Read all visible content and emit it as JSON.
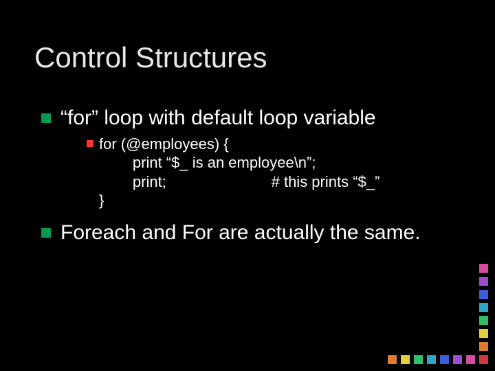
{
  "title": "Control Structures",
  "items": [
    {
      "level": 1,
      "text": "“for” loop with default loop variable"
    },
    {
      "level": 2,
      "code_lines": [
        "for (@employees) {",
        "        print “$_ is an employee\\n”;",
        "        print;                         # this prints “$_”",
        "}"
      ]
    },
    {
      "level": 1,
      "text": "Foreach and For are actually the same."
    }
  ],
  "deco_colors": {
    "vertical": [
      "#d84aa0",
      "#9a4fd1",
      "#3f5fd9",
      "#2fa5c7",
      "#2fbf6a",
      "#e2d23a",
      "#e07a2f"
    ],
    "horizontal": [
      "#e07a2f",
      "#e2d23a",
      "#2fbf6a",
      "#2fa5c7",
      "#3f5fd9",
      "#9a4fd1",
      "#d84aa0",
      "#d03a3a"
    ]
  }
}
